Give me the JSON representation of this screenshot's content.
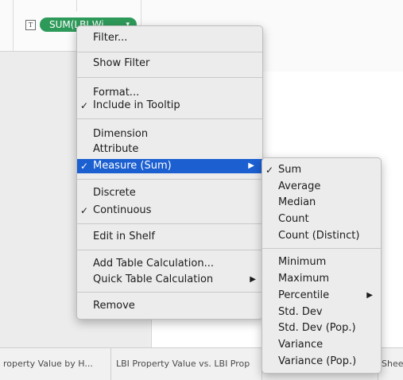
{
  "shelf": {
    "type_icon": "T",
    "pill_label": "SUM(LBI Wi..",
    "pill_caret": "▾",
    "pill_color": "#2e9a5a"
  },
  "main_menu": {
    "items": [
      {
        "label": "Filter...",
        "checked": false,
        "submenu": false
      },
      {
        "label": "Show Filter",
        "checked": false,
        "submenu": false
      },
      {
        "label": "Format...",
        "checked": false,
        "submenu": false
      },
      {
        "label": "Include in Tooltip",
        "checked": true,
        "submenu": false
      },
      {
        "label": "Dimension",
        "checked": false,
        "submenu": false
      },
      {
        "label": "Attribute",
        "checked": false,
        "submenu": false
      },
      {
        "label": "Measure (Sum)",
        "checked": true,
        "submenu": true,
        "selected": true
      },
      {
        "label": "Discrete",
        "checked": false,
        "submenu": false
      },
      {
        "label": "Continuous",
        "checked": true,
        "submenu": false
      },
      {
        "label": "Edit in Shelf",
        "checked": false,
        "submenu": false
      },
      {
        "label": "Add Table Calculation...",
        "checked": false,
        "submenu": false
      },
      {
        "label": "Quick Table Calculation",
        "checked": false,
        "submenu": true
      },
      {
        "label": "Remove",
        "checked": false,
        "submenu": false
      }
    ]
  },
  "sub_menu": {
    "items": [
      {
        "label": "Sum",
        "checked": true
      },
      {
        "label": "Average",
        "checked": false
      },
      {
        "label": "Median",
        "checked": false
      },
      {
        "label": "Count",
        "checked": false
      },
      {
        "label": "Count (Distinct)",
        "checked": false
      },
      {
        "label": "Minimum",
        "checked": false
      },
      {
        "label": "Maximum",
        "checked": false
      },
      {
        "label": "Percentile",
        "checked": false,
        "submenu": true
      },
      {
        "label": "Std. Dev",
        "checked": false
      },
      {
        "label": "Std. Dev (Pop.)",
        "checked": false
      },
      {
        "label": "Variance",
        "checked": false
      },
      {
        "label": "Variance (Pop.)",
        "checked": false
      }
    ]
  },
  "glyphs": {
    "check": "✓",
    "arrow": "▶"
  },
  "tabs": [
    {
      "label": "roperty Value by H..."
    },
    {
      "label": "LBI Property Value vs. LBI Prop"
    },
    {
      "label": "Sheet"
    }
  ],
  "colors": {
    "selection": "#1b5fd1",
    "menu_bg": "#ececec"
  }
}
